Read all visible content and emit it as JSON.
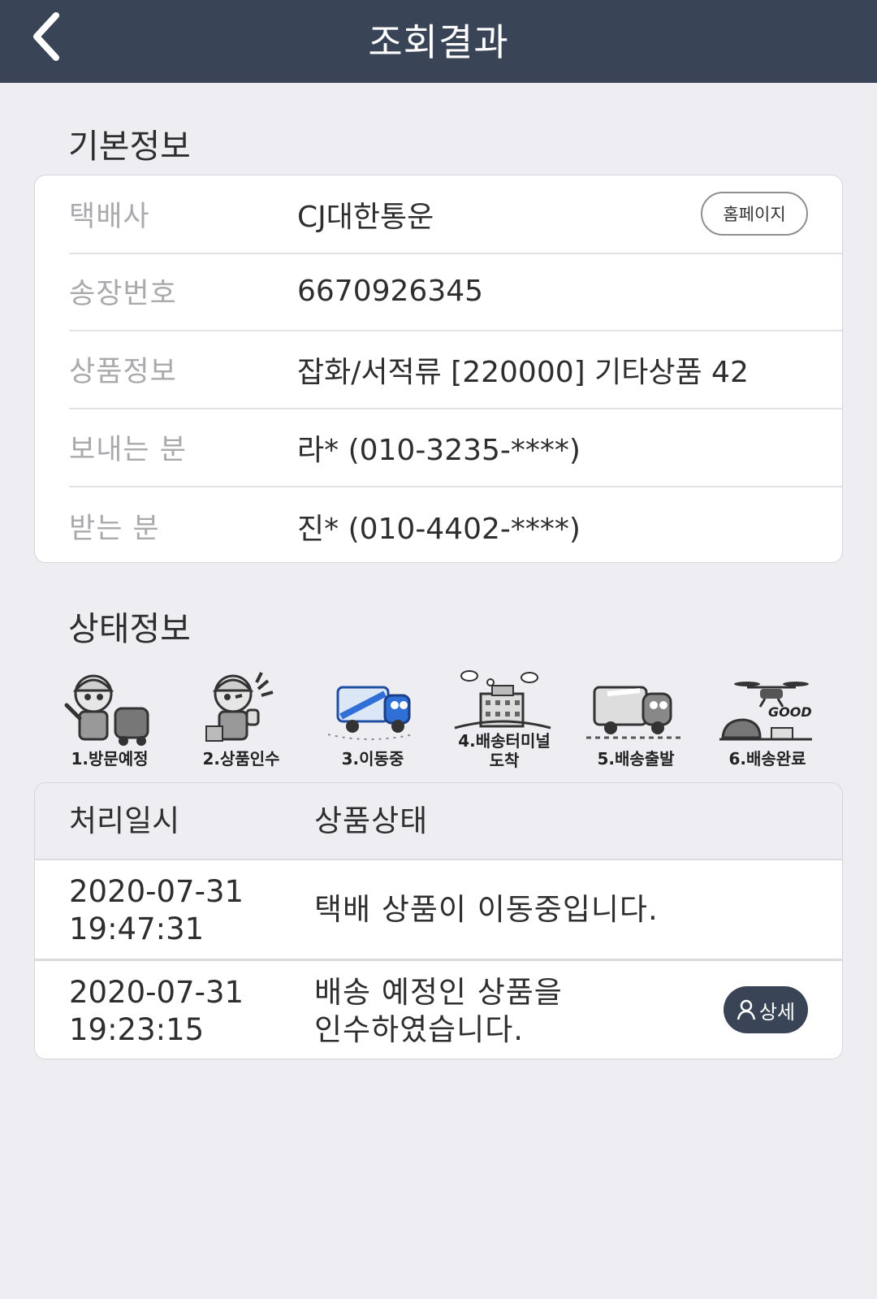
{
  "header": {
    "title": "조회결과",
    "back_icon": "chevron-left-icon"
  },
  "basic": {
    "section_title": "기본정보",
    "rows": [
      {
        "label": "택배사",
        "value": "CJ대한통운"
      },
      {
        "label": "송장번호",
        "value": "6670926345"
      },
      {
        "label": "상품정보",
        "value": "잡화/서적류 [220000] 기타상품 42"
      },
      {
        "label": "보내는 분",
        "value": "라* (010-3235-****)"
      },
      {
        "label": "받는 분",
        "value": "진* (010-4402-****)"
      }
    ],
    "homepage_label": "홈페이지"
  },
  "status": {
    "section_title": "상태정보",
    "steps": [
      {
        "label": "1.방문예정"
      },
      {
        "label": "2.상품인수"
      },
      {
        "label": "3.이동중"
      },
      {
        "label": "4.배송터미널",
        "label2": "도착"
      },
      {
        "label": "5.배송출발"
      },
      {
        "label": "6.배송완료",
        "sign": "GOOD"
      }
    ],
    "columns": {
      "time": "처리일시",
      "status": "상품상태"
    },
    "rows": [
      {
        "date": "2020-07-31",
        "time": "19:47:31",
        "line1": "택배 상품이 이동중입니다.",
        "line2": ""
      },
      {
        "date": "2020-07-31",
        "time": "19:23:15",
        "line1": "배송 예정인 상품을",
        "line2": "인수하였습니다.",
        "detail_label": "상세"
      }
    ]
  },
  "colors": {
    "header_bg": "#3a4457",
    "page_bg": "#eeedf2"
  }
}
